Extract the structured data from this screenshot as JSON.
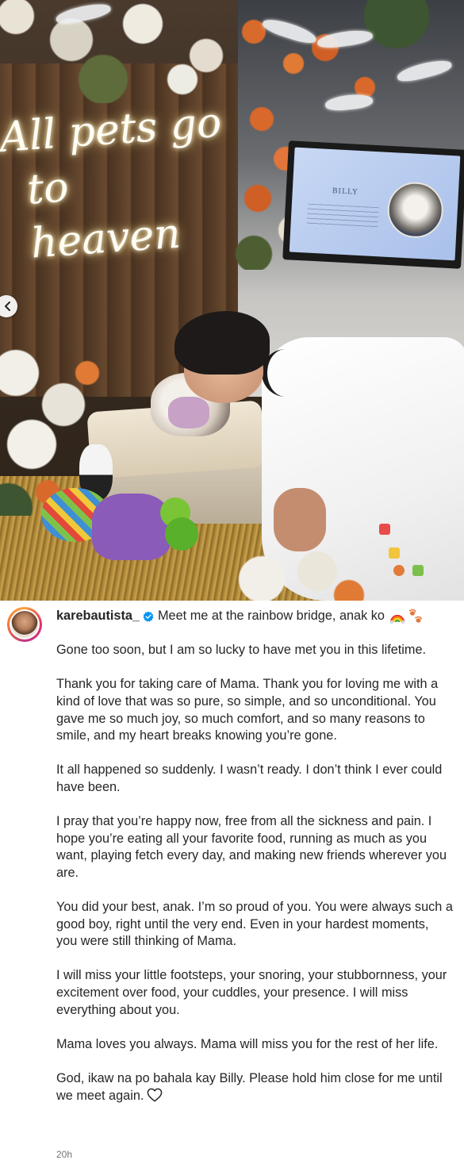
{
  "post": {
    "photo": {
      "neon_sign_line1": "All pets go",
      "neon_sign_line2": "to heaven",
      "tv_screen_name": "BILLY"
    },
    "carousel_prev_icon": "chevron-left-icon",
    "author": {
      "username": "karebautista_",
      "verified_icon": "verified-badge-icon",
      "verified_color": "#0095F6"
    },
    "caption": {
      "headline": "Meet me at the rainbow bridge, anak ko",
      "headline_emojis": [
        "rainbow-emoji",
        "paw-prints-emoji"
      ],
      "paragraphs": [
        "Gone too soon, but I am so lucky to have met you in this lifetime.",
        "Thank you for taking care of Mama. Thank you for loving me with a kind of love that was so pure, so simple, and so unconditional. You gave me so much joy, so much comfort, and so many reasons to smile, and my heart breaks knowing you’re gone.",
        "It all happened so suddenly. I wasn’t ready. I don’t think I ever could have been.",
        "I pray that you’re happy now, free from all the sickness and pain. I hope you’re eating all your favorite food, running as much as you want, playing fetch every day, and making new friends wherever you are.",
        "You did your best, anak. I’m so proud of you. You were always such a good boy, right until the very end. Even in your hardest moments, you were still thinking of Mama.",
        "I will miss your little footsteps, your snoring, your stubbornness, your excitement over food, your cuddles, your presence. I will miss everything about you.",
        "Mama loves you always. Mama will miss you for the rest of her life.",
        "God, ikaw na po bahala kay Billy. Please hold him close for me until we meet again."
      ],
      "trailing_icon": "heart-outline-icon"
    },
    "timestamp": "20h"
  },
  "colors": {
    "text": "#262626",
    "secondary_text": "#737373",
    "background": "#FFFFFF",
    "verified": "#0095F6"
  }
}
